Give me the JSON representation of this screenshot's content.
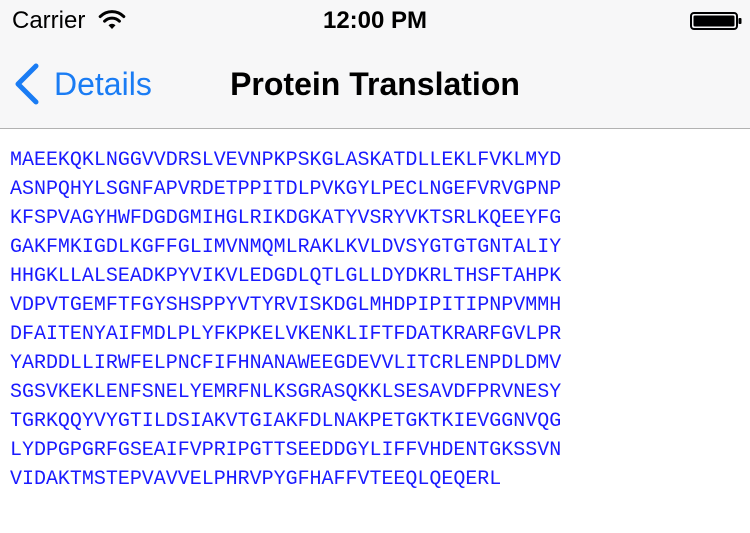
{
  "status_bar": {
    "carrier": "Carrier",
    "time": "12:00 PM",
    "wifi_icon": "wifi-icon",
    "battery_icon": "battery-icon"
  },
  "nav": {
    "back_label": "Details",
    "back_icon": "chevron-left-icon",
    "title": "Protein Translation",
    "accent_color": "#1a7cf4"
  },
  "sequence": {
    "color": "#1a1aff",
    "lines": [
      "MAEEKQKLNGGVVDRSLVEVNPKPSKGLASKATDLLEKLFVKLMYD",
      "ASNPQHYLSGNFAPVRDETPPITDLPVKGYLPECLNGEFVRVGPNP",
      "KFSPVAGYHWFDGDGMIHGLRIKDGKATYVSRYVKTSRLKQEEYFG",
      "GAKFMKIGDLKGFFGLIMVNMQMLRAKLKVLDVSYGTGTGNTALIY",
      "HHGKLLALSEADKPYVIKVLEDGDLQTLGLLDYDKRLTHSFTAHPK",
      "VDPVTGEMFTFGYSHSPPYVTYRVISKDGLMHDPIPITIPNPVMMH",
      "DFAITENYAIFMDLPLYFKPKELVKENKLIFTFDATKRARFGVLPR",
      "YARDDLLIRWFELPNCFIFHNANAWEEGDEVVLITCRLENPDLDMV",
      "SGSVKEKLENFSNELYEMRFNLKSGRASQKKLSESAVDFPRVNESY",
      "TGRKQQYVYGTILDSIAKVTGIAKFDLNAKPETGKTKIEVGGNVQG",
      "LYDPGPGRFGSEAIFVPRIPGTTSEEDDGYLIFFVHDENTGKSSVN",
      "VIDAKTMSTEPVAVVELPHRVPYGFHAFFVTEEQLQEQERL"
    ]
  }
}
